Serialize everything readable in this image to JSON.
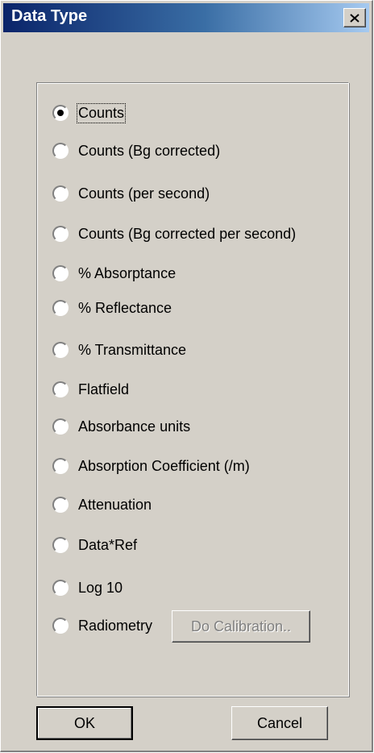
{
  "window": {
    "title": "Data Type"
  },
  "options": [
    {
      "label": "Counts",
      "selected": true
    },
    {
      "label": "Counts (Bg corrected)",
      "selected": false
    },
    {
      "label": "Counts (per second)",
      "selected": false
    },
    {
      "label": "Counts (Bg corrected per second)",
      "selected": false
    },
    {
      "label": "% Absorptance",
      "selected": false
    },
    {
      "label": "% Reflectance",
      "selected": false
    },
    {
      "label": "% Transmittance",
      "selected": false
    },
    {
      "label": "Flatfield",
      "selected": false
    },
    {
      "label": "Absorbance units",
      "selected": false
    },
    {
      "label": "Absorption Coefficient (/m)",
      "selected": false
    },
    {
      "label": "Attenuation",
      "selected": false
    },
    {
      "label": "Data*Ref",
      "selected": false
    },
    {
      "label": "Log 10",
      "selected": false
    },
    {
      "label": "Radiometry",
      "selected": false
    }
  ],
  "calibration_button": {
    "label": "Do Calibration..",
    "enabled": false
  },
  "buttons": {
    "ok": "OK",
    "cancel": "Cancel"
  },
  "colors": {
    "titlebar_start": "#0a246a",
    "titlebar_end": "#a6caf0",
    "face": "#d4d0c8"
  },
  "icons": {
    "close": "close-icon"
  }
}
